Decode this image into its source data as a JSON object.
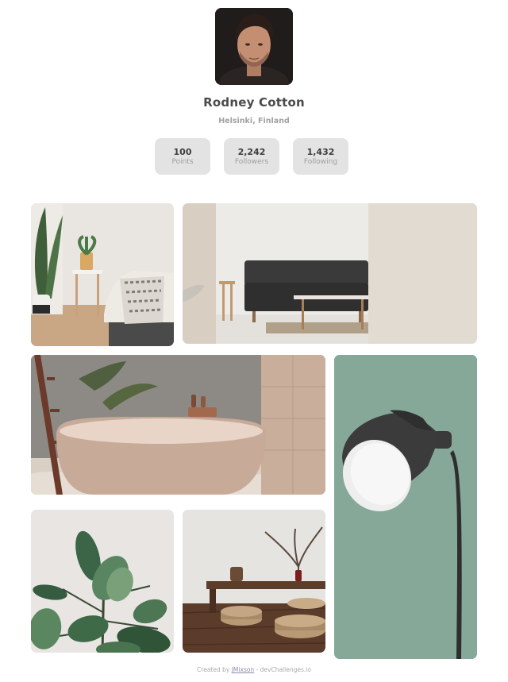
{
  "profile": {
    "name": "Rodney Cotton",
    "location": "Helsinki, Finland"
  },
  "stats": [
    {
      "value": "100",
      "label": "Points"
    },
    {
      "value": "2,242",
      "label": "Followers"
    },
    {
      "value": "1,432",
      "label": "Following"
    }
  ],
  "gallery": {
    "tiles": [
      {
        "subject": "bedroom-with-plant"
      },
      {
        "subject": "living-room-sofa"
      },
      {
        "subject": "bathtub"
      },
      {
        "subject": "floor-lamp"
      },
      {
        "subject": "rubber-plant-leaves"
      },
      {
        "subject": "low-table-interior"
      }
    ]
  },
  "footer": {
    "prefix": "Created by ",
    "author": "JMixson",
    "separator": " - ",
    "site": "devChallenges.io"
  },
  "colors": {
    "stat_bg": "#e3e3e3",
    "name_text": "#4a4a4a",
    "sub_text": "#a2a2a2"
  }
}
